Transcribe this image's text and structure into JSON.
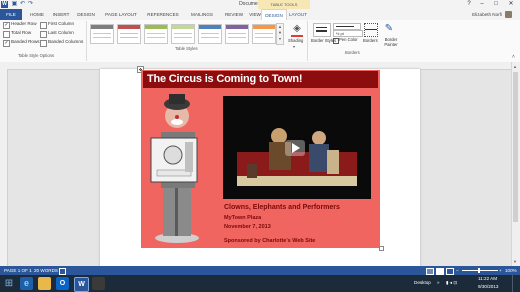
{
  "window": {
    "title": "Document1 - Word",
    "context_tab_group": "TABLE TOOLS",
    "user": "Elizabeth Norfi"
  },
  "tabs": [
    "FILE",
    "HOME",
    "INSERT",
    "DESIGN",
    "PAGE LAYOUT",
    "REFERENCES",
    "MAILINGS",
    "REVIEW",
    "VIEW",
    "DESIGN",
    "LAYOUT"
  ],
  "ribbon": {
    "style_options": {
      "items": [
        {
          "label": "Header Row",
          "checked": true
        },
        {
          "label": "First Column",
          "checked": false
        },
        {
          "label": "Total Row",
          "checked": false
        },
        {
          "label": "Last Column",
          "checked": false
        },
        {
          "label": "Banded Rows",
          "checked": true
        },
        {
          "label": "Banded Columns",
          "checked": false
        }
      ],
      "group_label": "Table Style Options"
    },
    "table_styles": {
      "group_label": "Table Styles"
    },
    "shading_label": "Shading",
    "border_styles_label": "Border Styles",
    "pen_weight": "½ pt",
    "pen_color_label": "Pen Color",
    "borders_label": "Borders",
    "border_painter_label": "Border Painter",
    "borders_group_label": "Borders"
  },
  "document": {
    "banner": "The Circus is Coming to Town!",
    "caption_title": "Clowns, Elephants and Performers",
    "venue": "MyTown Plaza",
    "date": "November 7, 2013",
    "sponsor": "Sponsored by Charlotte's Web Site"
  },
  "status": {
    "page": "PAGE 1 OF 1",
    "words": "20 WORDS",
    "zoom": "100%"
  },
  "taskbar": {
    "desktop_label": "Desktop",
    "time": "11:22 AM",
    "date": "9/30/2013"
  },
  "colors": {
    "word_blue": "#2b579a",
    "table_red": "#f06560",
    "banner_dark_red": "#8b0d0d"
  }
}
